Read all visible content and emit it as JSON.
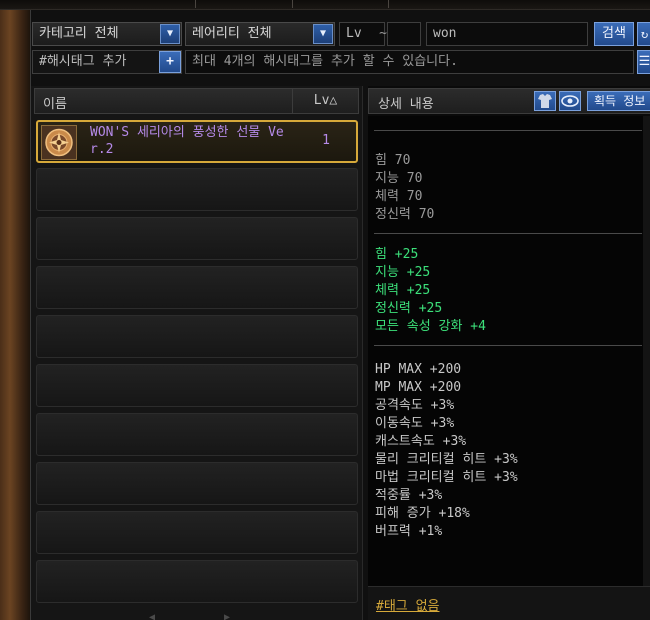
{
  "filters": {
    "category": "카테고리 전체",
    "rarity": "레어리티 전체",
    "lv_label": "Lv",
    "lv_sep": "~",
    "lv_min": "",
    "lv_max": "",
    "search_value": "won",
    "search_button": "검색",
    "hashtag_label": "#해시태그 추가",
    "hashtag_add": "+",
    "hashtag_placeholder": "최대 4개의 해시태그를 추가 할 수 있습니다."
  },
  "list": {
    "col_name": "이름",
    "col_lv": "Lv△",
    "items": [
      {
        "name": "WON'S 세리아의 풍성한 선물 Ver.2",
        "lv": "1",
        "icon": "sun-emblem-icon"
      }
    ]
  },
  "detail": {
    "title": "상세 내용",
    "acquire_label": "획득 정보",
    "base_stats": [
      "힘 70",
      "지능 70",
      "체력 70",
      "정신력 70"
    ],
    "bonus_stats": [
      "힘 +25",
      "지능 +25",
      "체력 +25",
      "정신력 +25",
      "모든 속성 강화 +4"
    ],
    "extra_stats": [
      "HP MAX +200",
      "MP MAX +200",
      "공격속도 +3%",
      "이동속도 +3%",
      "캐스트속도 +3%",
      "물리 크리티컬 히트 +3%",
      "마법 크리티컬 히트 +3%",
      "적중률 +3%",
      "피해 증가 +18%",
      "버프력 +1%"
    ],
    "tag_text": "#태그 없음"
  },
  "colors": {
    "bonus": "#3ce07a",
    "item_name": "#b58ae8",
    "selected_border": "#d6a93a"
  }
}
